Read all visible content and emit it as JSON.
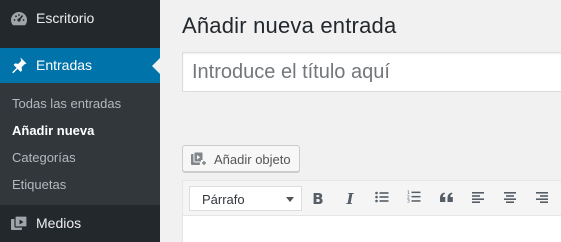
{
  "sidebar": {
    "items": [
      {
        "label": "Escritorio",
        "icon": "dashboard-icon"
      },
      {
        "label": "Entradas",
        "icon": "pin-icon",
        "active": true
      },
      {
        "label": "Medios",
        "icon": "media-icon"
      }
    ],
    "submenu": [
      {
        "label": "Todas las entradas"
      },
      {
        "label": "Añadir nueva",
        "current": true
      },
      {
        "label": "Categorías"
      },
      {
        "label": "Etiquetas"
      }
    ],
    "colors": {
      "background": "#23282d",
      "active": "#0073aa",
      "submenu": "#32373c"
    }
  },
  "main": {
    "title": "Añadir nueva entrada",
    "title_input": {
      "placeholder": "Introduce el título aquí",
      "value": ""
    },
    "media_button": {
      "label": "Añadir objeto",
      "icon": "add-media-icon"
    },
    "toolbar": {
      "format": "Párrafo",
      "buttons": [
        "bold-icon",
        "italic-icon",
        "bullet-list-icon",
        "numbered-list-icon",
        "blockquote-icon",
        "align-left-icon",
        "align-center-icon",
        "align-right-icon"
      ],
      "bold_glyph": "B",
      "italic_glyph": "I"
    }
  }
}
